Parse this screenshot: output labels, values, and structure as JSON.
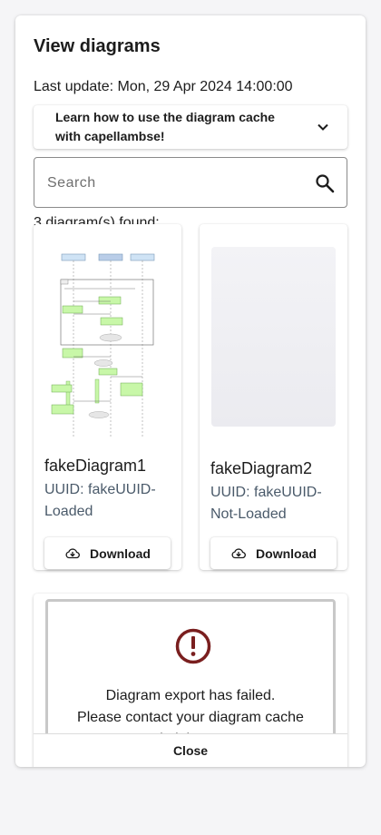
{
  "dialog": {
    "title": "View diagrams",
    "last_update": "Last update: Mon, 29 Apr 2024 14:00:00",
    "accordion": {
      "label": "Learn how to use the diagram cache with capellambse!",
      "icon": "chevron-down-icon"
    },
    "search": {
      "placeholder": "Search",
      "value": "",
      "icon": "search-icon"
    },
    "found_text": "3 diagram(s) found:",
    "diagrams": [
      {
        "name": "fakeDiagram1",
        "uuid": "UUID: fakeUUID-Loaded",
        "download_label": "Download",
        "download_icon": "cloud-download-icon"
      },
      {
        "name": "fakeDiagram2",
        "uuid": "UUID: fakeUUID-Not-Loaded",
        "download_label": "Download",
        "download_icon": "cloud-download-icon"
      }
    ],
    "error": {
      "icon": "error-icon",
      "line1": "Diagram export has failed.",
      "line2": "Please contact your diagram cache administrator."
    },
    "close_label": "Close"
  },
  "colors": {
    "error_red": "#7a1f1f",
    "uuid_text": "#4a5a6a",
    "background": "#f5f5f7"
  }
}
